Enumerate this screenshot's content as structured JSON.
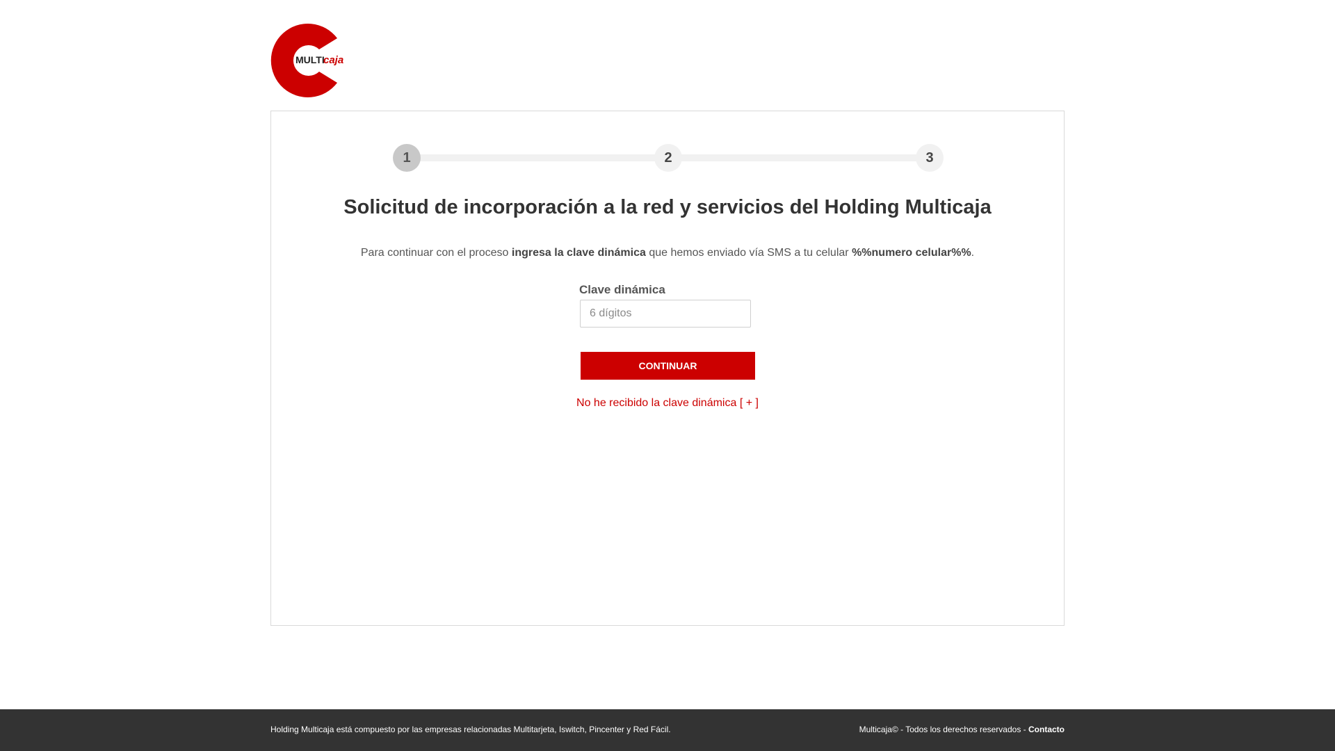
{
  "brand": {
    "logo_text_bold": "MULTI",
    "logo_text_italic": "caja",
    "primary_color": "#cc0000"
  },
  "stepper": {
    "steps": [
      "1",
      "2",
      "3"
    ],
    "active_index": 0
  },
  "main": {
    "title": "Solicitud de incorporación a la red y servicios del Holding Multicaja",
    "desc_part1": "Para continuar con el proceso ",
    "desc_bold1": "ingresa la clave dinámica",
    "desc_part2": " que hemos enviado vía SMS a tu celular ",
    "desc_bold2": "%%numero celular%%",
    "desc_part3": ".",
    "field_label": "Clave dinámica",
    "field_placeholder": "6 dígitos",
    "field_value": "",
    "submit_label": "CONTINUAR",
    "resend_label": "No he recibido la clave dinámica [ + ]"
  },
  "footer": {
    "left_text": "Holding Multicaja está compuesto por las empresas relacionadas Multitarjeta, Iswitch, Pincenter y Red Fácil.",
    "right_text": "Multicaja© - Todos los derechos reservados - ",
    "contact_label": "Contacto"
  }
}
